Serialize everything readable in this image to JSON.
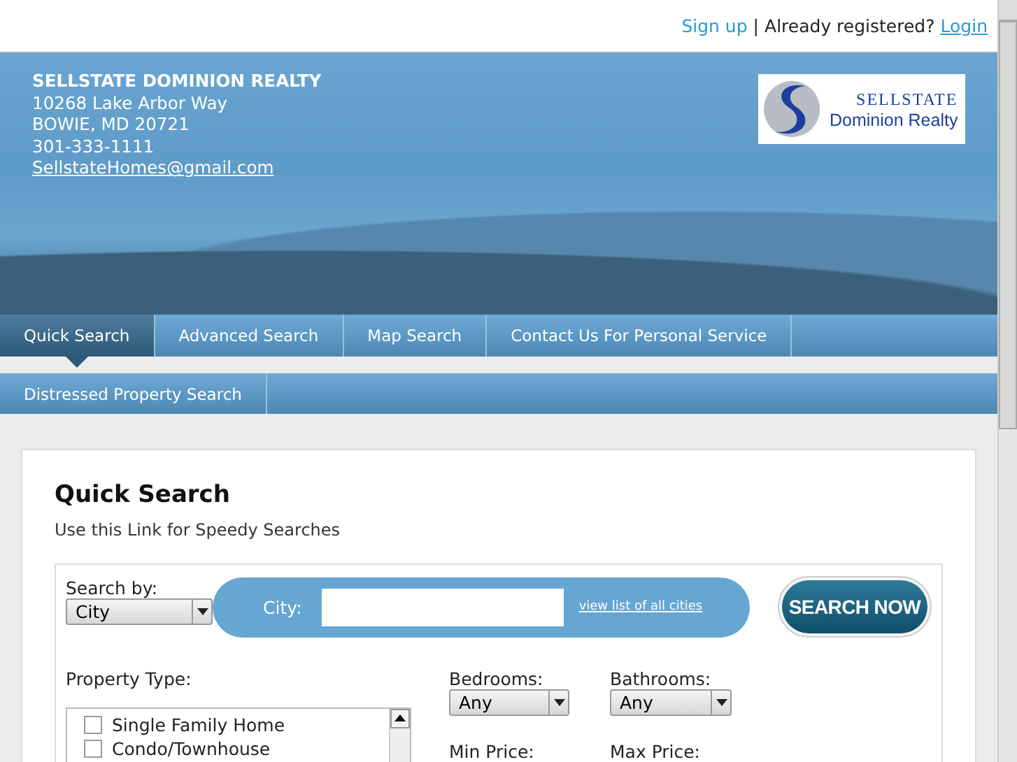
{
  "top_bar": {
    "signup_link": "Sign up",
    "separator": "|",
    "registered_text": "Already registered?",
    "login_link": "Login"
  },
  "header": {
    "company": "SELLSTATE DOMINION REALTY",
    "address_lines": [
      "10268 Lake Arbor Way",
      "BOWIE, MD 20721",
      "301-333-1111"
    ],
    "email": "SellstateHomes@gmail.com",
    "logo": {
      "brand": "SELLSTATE",
      "subtitle": "Dominion Realty"
    }
  },
  "nav_rows": [
    [
      {
        "label": "Quick Search",
        "selected": true
      },
      {
        "label": "Advanced Search",
        "selected": false
      },
      {
        "label": "Map Search",
        "selected": false
      },
      {
        "label": "Contact Us For Personal Service",
        "selected": false
      }
    ],
    [
      {
        "label": "Distressed Property Search",
        "selected": false
      }
    ]
  ],
  "quick_search": {
    "title": "Quick Search",
    "subtitle": "Use this Link for Speedy Searches",
    "search_by": {
      "label": "Search by:",
      "value": "City"
    },
    "city": {
      "label": "City:",
      "link": "view list of all cities"
    },
    "search_button": "SEARCH NOW",
    "property_type": {
      "label": "Property Type:",
      "options": [
        {
          "label": "Single Family Home",
          "checked": false
        },
        {
          "label": "Condo/Townhouse",
          "checked": false
        }
      ]
    },
    "bedrooms": {
      "label": "Bedrooms:",
      "value": "Any"
    },
    "bathrooms": {
      "label": "Bathrooms:",
      "value": "Any"
    },
    "min_price": {
      "label": "Min Price:"
    },
    "max_price": {
      "label": "Max Price:"
    }
  }
}
